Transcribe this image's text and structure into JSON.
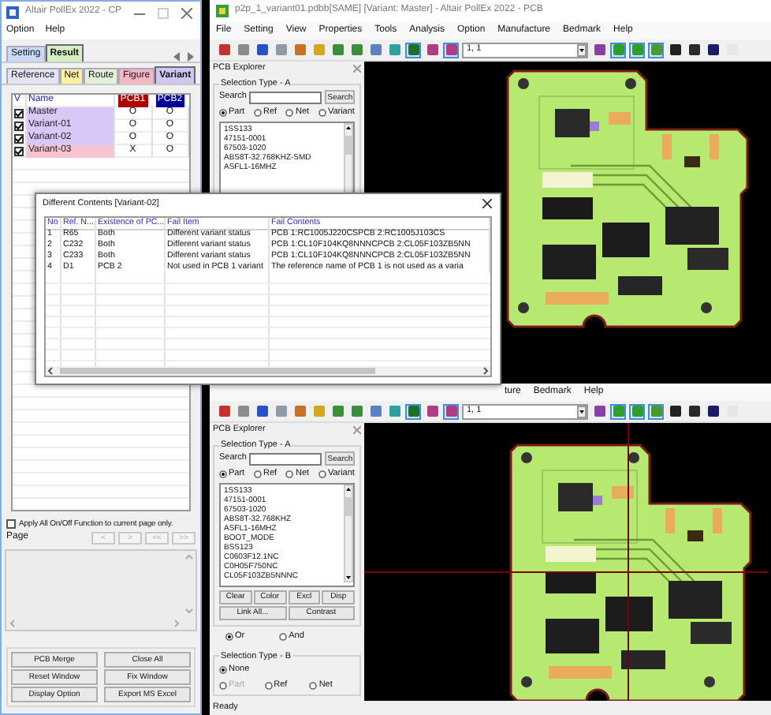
{
  "cp_window": {
    "title": "Altair PollEx 2022 - CP",
    "menu": [
      "Option",
      "Help"
    ],
    "top_tabs": [
      {
        "label": "Setting",
        "color": "#c9d9f6",
        "selected": false
      },
      {
        "label": "Result",
        "color": "#d6efc2",
        "selected": true
      }
    ],
    "sub_tabs": [
      {
        "label": "Reference",
        "color": "#e4e4f6",
        "selected": false
      },
      {
        "label": "Net",
        "color": "#fff1a0",
        "selected": false
      },
      {
        "label": "Route",
        "color": "#e2f2da",
        "selected": false
      },
      {
        "label": "Figure",
        "color": "#f6b6c6",
        "selected": false
      },
      {
        "label": "Variant",
        "color": "#cfc6f2",
        "selected": true
      }
    ],
    "variant_table": {
      "columns": [
        {
          "label": "V"
        },
        {
          "label": "Name"
        },
        {
          "label": "PCB1",
          "color": "#b00000"
        },
        {
          "label": "PCB2",
          "color": "#000099"
        }
      ],
      "rows": [
        {
          "checked": true,
          "name": "Master",
          "color": "#d9c8f7",
          "pcb1": "O",
          "pcb2": "O"
        },
        {
          "checked": true,
          "name": "Variant-01",
          "color": "#d9c8f7",
          "pcb1": "O",
          "pcb2": "O"
        },
        {
          "checked": true,
          "name": "Variant-02",
          "color": "#d9c8f7",
          "pcb1": "O",
          "pcb2": "O"
        },
        {
          "checked": true,
          "name": "Variant-03",
          "color": "#f7c3cf",
          "pcb1": "X",
          "pcb2": "O"
        }
      ]
    },
    "apply_checkbox": {
      "label": "Apply All On/Off Function to current page only.",
      "checked": false
    },
    "page_label": "Page",
    "page_buttons": [
      {
        "label": "<",
        "disabled": true
      },
      {
        "label": ">",
        "disabled": true
      },
      {
        "label": "<<",
        "disabled": true
      },
      {
        "label": ">>",
        "disabled": true
      }
    ],
    "buttons": [
      "PCB Merge",
      "Close All",
      "Reset Window",
      "Fix Window",
      "Display Option",
      "Export MS Excel"
    ]
  },
  "pcb_windows": [
    {
      "title": "p2p_1_variant01.pdbb[SAME] [Variant: Master] - Altair PollEx 2022 - PCB",
      "menu": [
        "File",
        "Setting",
        "View",
        "Properties",
        "Tools",
        "Analysis",
        "Option",
        "Manufacture",
        "Bedmark",
        "Help"
      ],
      "toolbar": [
        {
          "pressed": false
        },
        {
          "pressed": false
        },
        {
          "pressed": false
        },
        {
          "pressed": false
        },
        {
          "pressed": false
        },
        {
          "pressed": false
        },
        {
          "pressed": false
        },
        {
          "pressed": false
        },
        {
          "pressed": false
        },
        {
          "pressed": false
        },
        {
          "pressed": true
        },
        {
          "pressed": false
        },
        {
          "pressed": true
        },
        {
          "pressed": false
        },
        {
          "pressed": true
        },
        {
          "pressed": true
        },
        {
          "pressed": true
        },
        {
          "pressed": false
        },
        {
          "pressed": false
        },
        {
          "pressed": false
        },
        {
          "pressed": false
        }
      ],
      "layer_select": "1, 1",
      "explorer": {
        "title": "PCB Explorer",
        "group_title": "Selection Type - A",
        "search_label": "Search",
        "search_button": "Search",
        "radios": [
          {
            "label": "Part",
            "selected": true
          },
          {
            "label": "Ref",
            "selected": false
          },
          {
            "label": "Net",
            "selected": false
          },
          {
            "label": "Variant",
            "selected": false
          }
        ],
        "items": [
          "1SS133",
          "47151-0001",
          "67503-1020",
          "ABS8T-32.768KHZ-SMD",
          "ASFL1-16MHZ"
        ]
      }
    },
    {
      "menu": [
        "ture",
        "Bedmark",
        "Help"
      ],
      "toolbar": [
        {
          "pressed": false
        },
        {
          "pressed": false
        },
        {
          "pressed": false
        },
        {
          "pressed": false
        },
        {
          "pressed": false
        },
        {
          "pressed": false
        },
        {
          "pressed": false
        },
        {
          "pressed": false
        },
        {
          "pressed": false
        },
        {
          "pressed": false
        },
        {
          "pressed": true
        },
        {
          "pressed": false
        },
        {
          "pressed": true
        },
        {
          "pressed": false
        },
        {
          "pressed": true
        },
        {
          "pressed": true
        },
        {
          "pressed": true
        },
        {
          "pressed": false
        },
        {
          "pressed": false
        },
        {
          "pressed": false
        },
        {
          "pressed": false
        }
      ],
      "layer_select": "1, 1",
      "explorer": {
        "title": "PCB Explorer",
        "group_title": "Selection Type - A",
        "search_label": "Search",
        "search_button": "Search",
        "radios": [
          {
            "label": "Part",
            "selected": true
          },
          {
            "label": "Ref",
            "selected": false
          },
          {
            "label": "Net",
            "selected": false
          },
          {
            "label": "Variant",
            "selected": false
          }
        ],
        "items": [
          "1SS133",
          "47151-0001",
          "67503-1020",
          "ABS8T-32.768KHZ",
          "ASFL1-16MHZ",
          "BOOT_MODE",
          "BSS123",
          "C0603F12.1NC",
          "C0H05F750NC",
          "CL05F103ZB5NNNC"
        ],
        "actions": [
          "Clear",
          "Color",
          "Excl",
          "Disp",
          "Link All...",
          "Contrast"
        ],
        "logic": [
          {
            "label": "Or",
            "selected": true
          },
          {
            "label": "And",
            "selected": false
          }
        ],
        "group_b": {
          "title": "Selection Type - B",
          "radios": [
            {
              "label": "None",
              "selected": true,
              "disabled": false
            },
            {
              "label": "Part",
              "selected": false,
              "disabled": true
            },
            {
              "label": "Ref",
              "selected": false,
              "disabled": false
            },
            {
              "label": "Net",
              "selected": false,
              "disabled": false
            }
          ]
        }
      },
      "status": "Ready"
    }
  ],
  "dialog": {
    "title": "Different Contents [Variant-02]",
    "columns": [
      "No",
      "Ref. N...",
      "Existence of PC...",
      "Fail Item",
      "Fail Contents"
    ],
    "rows": [
      [
        "1",
        "R65",
        "Both",
        "Different variant status",
        "PCB 1:RC1005J220CSPCB 2:RC1005J103CS"
      ],
      [
        "2",
        "C232",
        "Both",
        "Different variant status",
        "PCB 1:CL10F104KQ8NNNCPCB 2:CL05F103ZB5NN"
      ],
      [
        "3",
        "C233",
        "Both",
        "Different variant status",
        "PCB 1:CL10F104KQ8NNNCPCB 2:CL05F103ZB5NN"
      ],
      [
        "4",
        "D1",
        "PCB 2",
        "Not used in PCB 1 variant",
        "The reference name of PCB 1 is not used as a varia"
      ]
    ]
  }
}
